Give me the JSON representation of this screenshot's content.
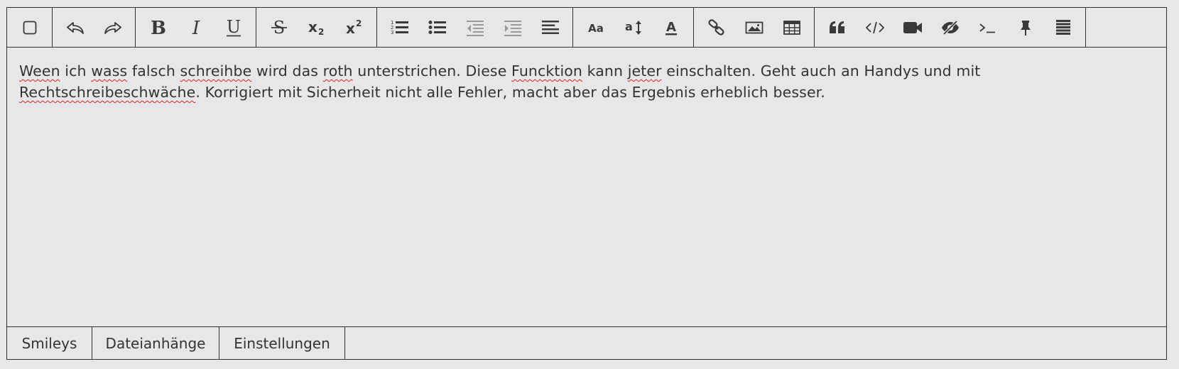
{
  "toolbar": {
    "groups": [
      [
        "toggle-icon"
      ],
      [
        "undo-icon",
        "redo-icon"
      ],
      [
        "bold-icon",
        "italic-icon",
        "underline-icon"
      ],
      [
        "strikethrough-icon",
        "subscript-icon",
        "superscript-icon"
      ],
      [
        "ordered-list-icon",
        "unordered-list-icon",
        "outdent-icon",
        "indent-icon",
        "align-icon"
      ],
      [
        "font-family-icon",
        "font-size-icon",
        "font-color-icon"
      ],
      [
        "link-icon",
        "image-icon",
        "table-icon"
      ],
      [
        "quote-icon",
        "code-icon",
        "video-icon",
        "spoiler-icon",
        "terminal-icon",
        "pin-icon",
        "more-icon"
      ]
    ],
    "glyphs": {
      "bold": "B",
      "italic": "I",
      "underline": "U",
      "strikethrough": "S",
      "subscript_base": "x",
      "subscript_sub": "2",
      "superscript_base": "x",
      "superscript_sup": "2",
      "font_family": "Aa",
      "font_size": "a",
      "font_color": "A"
    }
  },
  "editor": {
    "segments": [
      {
        "text": "Ween",
        "misspelled": true
      },
      {
        "text": " ich ",
        "misspelled": false
      },
      {
        "text": "wass",
        "misspelled": true
      },
      {
        "text": " falsch ",
        "misspelled": false
      },
      {
        "text": "schreihbe",
        "misspelled": true
      },
      {
        "text": " wird das ",
        "misspelled": false
      },
      {
        "text": "roth",
        "misspelled": true
      },
      {
        "text": " unterstrichen. Diese ",
        "misspelled": false
      },
      {
        "text": "Funcktion",
        "misspelled": true
      },
      {
        "text": " kann ",
        "misspelled": false
      },
      {
        "text": "jeter",
        "misspelled": true
      },
      {
        "text": " einschalten. Geht auch an Handys und mit ",
        "misspelled": false
      },
      {
        "text": "Rechtschreibeschwäche",
        "misspelled": true
      },
      {
        "text": ". Korrigiert mit Sicherheit nicht alle Fehler, macht aber das Ergebnis erheblich besser.",
        "misspelled": false
      }
    ]
  },
  "bottom_tabs": [
    "Smileys",
    "Dateianhänge",
    "Einstellungen"
  ],
  "colors": {
    "background": "#e7e7e9",
    "border": "#333333",
    "text": "#333333",
    "spellcheck_underline": "#dd2222",
    "icon_dark": "#3a3a3a",
    "icon_disabled": "#9a9a9a"
  }
}
